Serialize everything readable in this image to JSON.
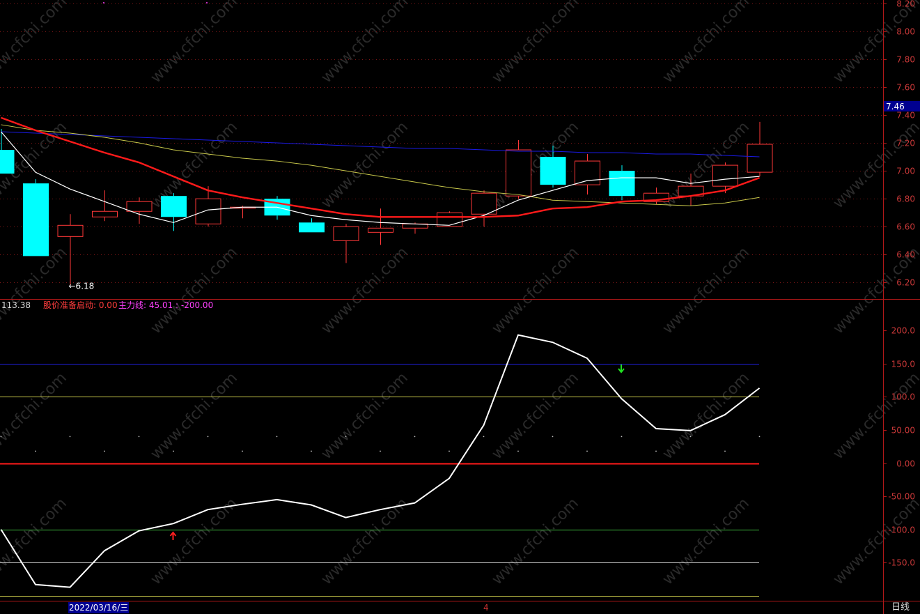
{
  "colors": {
    "background": "#000000",
    "axis_red": "#b01818",
    "grid": "#7a1616",
    "up_candle": "#ff3838",
    "down_candle": "#00ffff",
    "ma_short": "#ffffff",
    "ma_mid": "#ff1a1a",
    "ma_long_yellow": "#c8c84a",
    "ma_longest_blue": "#1a1ae6",
    "price_tag_bg": "#000090",
    "indicator_line": "#ffffff"
  },
  "watermark_text": "www.cfchi.com",
  "price_axis": {
    "ticks": [
      "8.20",
      "8.00",
      "7.80",
      "7.60",
      "7.40",
      "7.20",
      "7.00",
      "6.80",
      "6.60",
      "6.40",
      "6.20"
    ],
    "current_price_tag": "7.46"
  },
  "annotations": {
    "low_marker": "6.18"
  },
  "indicator_header": {
    "value": "113.38",
    "label1": "股价准备启动: 0.00",
    "label2": "主力线: 45.01 : -200.00"
  },
  "indicator_axis": {
    "ticks": [
      "200.0",
      "150.0",
      "100.0",
      "50.00",
      "0.00",
      "-50.00",
      "-100.0",
      "-150.0"
    ]
  },
  "footer": {
    "date": "2022/03/16/",
    "date_weekday": "三",
    "mid_tick": "4",
    "period": "日线"
  },
  "chart_data": [
    {
      "type": "candlestick",
      "title": "",
      "ylim": [
        6.15,
        8.2
      ],
      "candles": [
        {
          "o": 7.15,
          "h": 7.3,
          "l": 6.98,
          "c": 6.98
        },
        {
          "o": 6.91,
          "h": 6.94,
          "l": 6.39,
          "c": 6.39
        },
        {
          "o": 6.53,
          "h": 6.69,
          "l": 6.18,
          "c": 6.61
        },
        {
          "o": 6.67,
          "h": 6.86,
          "l": 6.64,
          "c": 6.71
        },
        {
          "o": 6.71,
          "h": 6.81,
          "l": 6.62,
          "c": 6.78
        },
        {
          "o": 6.82,
          "h": 6.84,
          "l": 6.57,
          "c": 6.67
        },
        {
          "o": 6.62,
          "h": 6.89,
          "l": 6.6,
          "c": 6.8
        },
        {
          "o": 6.74,
          "h": 6.75,
          "l": 6.66,
          "c": 6.74
        },
        {
          "o": 6.8,
          "h": 6.82,
          "l": 6.65,
          "c": 6.68
        },
        {
          "o": 6.63,
          "h": 6.66,
          "l": 6.56,
          "c": 6.56
        },
        {
          "o": 6.5,
          "h": 6.62,
          "l": 6.34,
          "c": 6.6
        },
        {
          "o": 6.56,
          "h": 6.73,
          "l": 6.47,
          "c": 6.59
        },
        {
          "o": 6.59,
          "h": 6.63,
          "l": 6.55,
          "c": 6.62
        },
        {
          "o": 6.6,
          "h": 6.71,
          "l": 6.6,
          "c": 6.7
        },
        {
          "o": 6.69,
          "h": 6.86,
          "l": 6.6,
          "c": 6.84
        },
        {
          "o": 6.82,
          "h": 7.22,
          "l": 6.8,
          "c": 7.15
        },
        {
          "o": 7.1,
          "h": 7.18,
          "l": 6.88,
          "c": 6.9
        },
        {
          "o": 6.9,
          "h": 7.12,
          "l": 6.83,
          "c": 7.07
        },
        {
          "o": 7.0,
          "h": 7.04,
          "l": 6.79,
          "c": 6.82
        },
        {
          "o": 6.78,
          "h": 6.88,
          "l": 6.76,
          "c": 6.84
        },
        {
          "o": 6.82,
          "h": 6.98,
          "l": 6.75,
          "c": 6.89
        },
        {
          "o": 6.89,
          "h": 7.06,
          "l": 6.84,
          "c": 7.04
        },
        {
          "o": 6.99,
          "h": 7.35,
          "l": 6.96,
          "c": 7.19
        }
      ],
      "series": [
        {
          "values": [
            7.28,
            6.99,
            6.87,
            6.78,
            6.69,
            6.63,
            6.72,
            6.74,
            6.74,
            6.68,
            6.65,
            6.63,
            6.62,
            6.61,
            6.68,
            6.79,
            6.86,
            6.93,
            6.95,
            6.95,
            6.91,
            6.94,
            6.96
          ]
        },
        {
          "values": [
            7.38,
            7.29,
            7.21,
            7.13,
            7.06,
            6.96,
            6.86,
            6.81,
            6.77,
            6.73,
            6.69,
            6.67,
            6.67,
            6.67,
            6.67,
            6.68,
            6.73,
            6.74,
            6.78,
            6.79,
            6.82,
            6.86,
            6.95
          ]
        },
        {
          "values": [
            7.33,
            7.29,
            7.27,
            7.24,
            7.2,
            7.15,
            7.12,
            7.09,
            7.07,
            7.04,
            7.0,
            6.96,
            6.92,
            6.88,
            6.85,
            6.83,
            6.79,
            6.78,
            6.77,
            6.76,
            6.75,
            6.77,
            6.81
          ]
        },
        {
          "values": [
            7.28,
            7.27,
            7.26,
            7.25,
            7.24,
            7.23,
            7.22,
            7.21,
            7.2,
            7.19,
            7.18,
            7.17,
            7.16,
            7.16,
            7.15,
            7.14,
            7.14,
            7.13,
            7.13,
            7.12,
            7.12,
            7.11,
            7.1
          ]
        }
      ]
    },
    {
      "type": "line",
      "title": "",
      "ylim": [
        -200,
        240
      ],
      "series": [
        {
          "values": [
            -100,
            -183,
            -187,
            -132,
            -102,
            -91,
            -70,
            -62,
            -55,
            -63,
            -82,
            -70,
            -60,
            -23,
            57,
            193,
            182,
            158,
            97,
            52,
            49,
            73,
            113
          ]
        }
      ],
      "reference_lines": [
        150,
        100,
        0,
        -100,
        -150,
        -200
      ],
      "dots_level": 40,
      "signals": [
        {
          "index": 5,
          "type": "buy"
        },
        {
          "index": 18,
          "type": "sell"
        }
      ]
    }
  ]
}
